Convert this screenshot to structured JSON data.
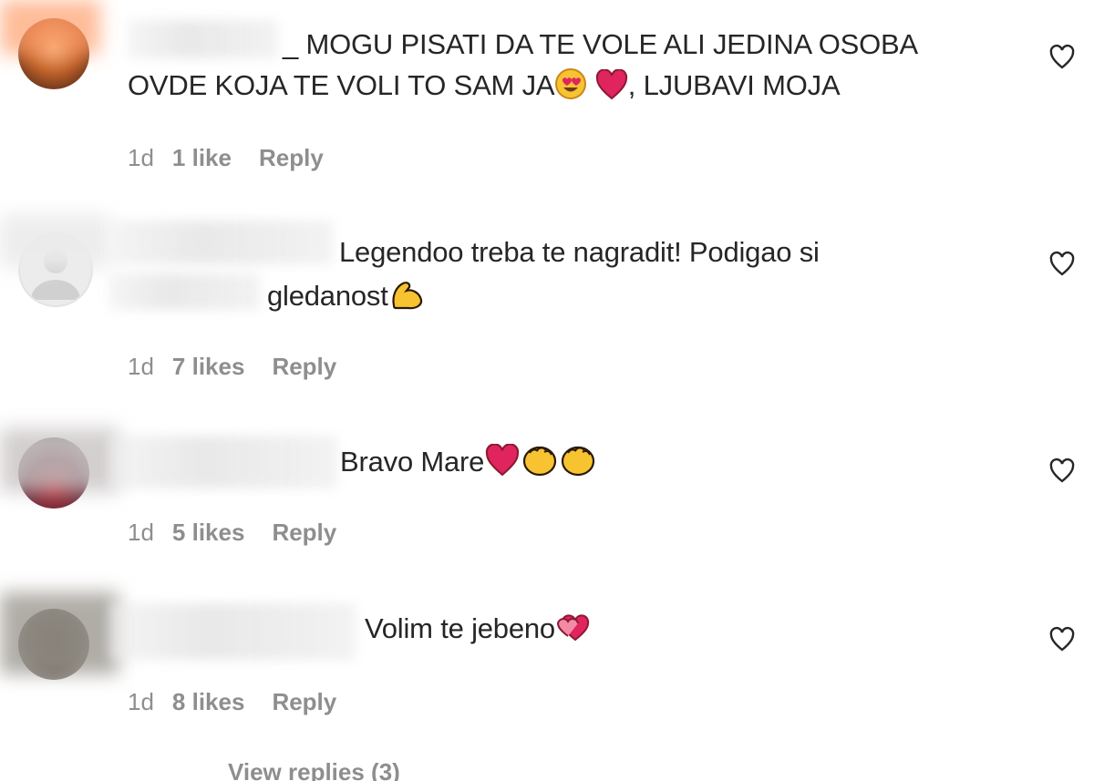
{
  "comments": [
    {
      "text_line1": "_ MOGU PISATI DA TE VOLE ALI JEDINA OSOBA",
      "text_line2_a": "OVDE KOJA TE VOLI TO SAM JA",
      "text_line2_b": ", LJUBAVI MOJA",
      "time": "1d",
      "likes": "1 like",
      "reply": "Reply"
    },
    {
      "text_line1": "Legendoo treba te nagradit! Podigao si",
      "text_line2_a": "gledanost",
      "time": "1d",
      "likes": "7 likes",
      "reply": "Reply"
    },
    {
      "text_line1": "Bravo Mare",
      "time": "1d",
      "likes": "5 likes",
      "reply": "Reply"
    },
    {
      "text_line1": "Volim te jebeno",
      "time": "1d",
      "likes": "8 likes",
      "reply": "Reply"
    }
  ],
  "view_replies": "View replies (3)",
  "colors": {
    "text": "#262626",
    "meta": "#8e8e8e",
    "heart_red": "#e0245e",
    "emoji_yellow": "#f7c331"
  },
  "icons": [
    "heart-outline-icon",
    "heart-eyes-emoji",
    "red-heart-emoji",
    "flexed-biceps-emoji",
    "clapping-hands-emoji",
    "two-hearts-emoji"
  ]
}
